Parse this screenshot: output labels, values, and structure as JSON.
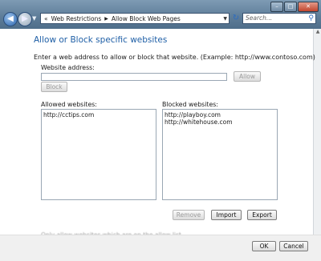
{
  "breadcrumb": {
    "root": "«",
    "items": [
      "Web Restrictions",
      "Allow Block Web Pages"
    ]
  },
  "search": {
    "placeholder": "Search..."
  },
  "window_buttons": {
    "minimize": "–",
    "maximize": "□",
    "close": "✕"
  },
  "page": {
    "heading": "Allow or Block specific websites",
    "instruction": "Enter a web address to allow or block that website.  (Example: http://www.contoso.com)",
    "website_address_label": "Website address:",
    "allow_label": "Allow",
    "block_label": "Block",
    "allowed_label": "Allowed websites:",
    "blocked_label": "Blocked websites:",
    "allowed_sites": [
      "http://cctips.com"
    ],
    "blocked_sites": [
      "http://playboy.com",
      "http://whitehouse.com"
    ],
    "remove_label": "Remove",
    "import_label": "Import",
    "export_label": "Export",
    "faded_text": "Only allow websites which are on the allow list"
  },
  "footer": {
    "ok_label": "OK",
    "cancel_label": "Cancel"
  }
}
